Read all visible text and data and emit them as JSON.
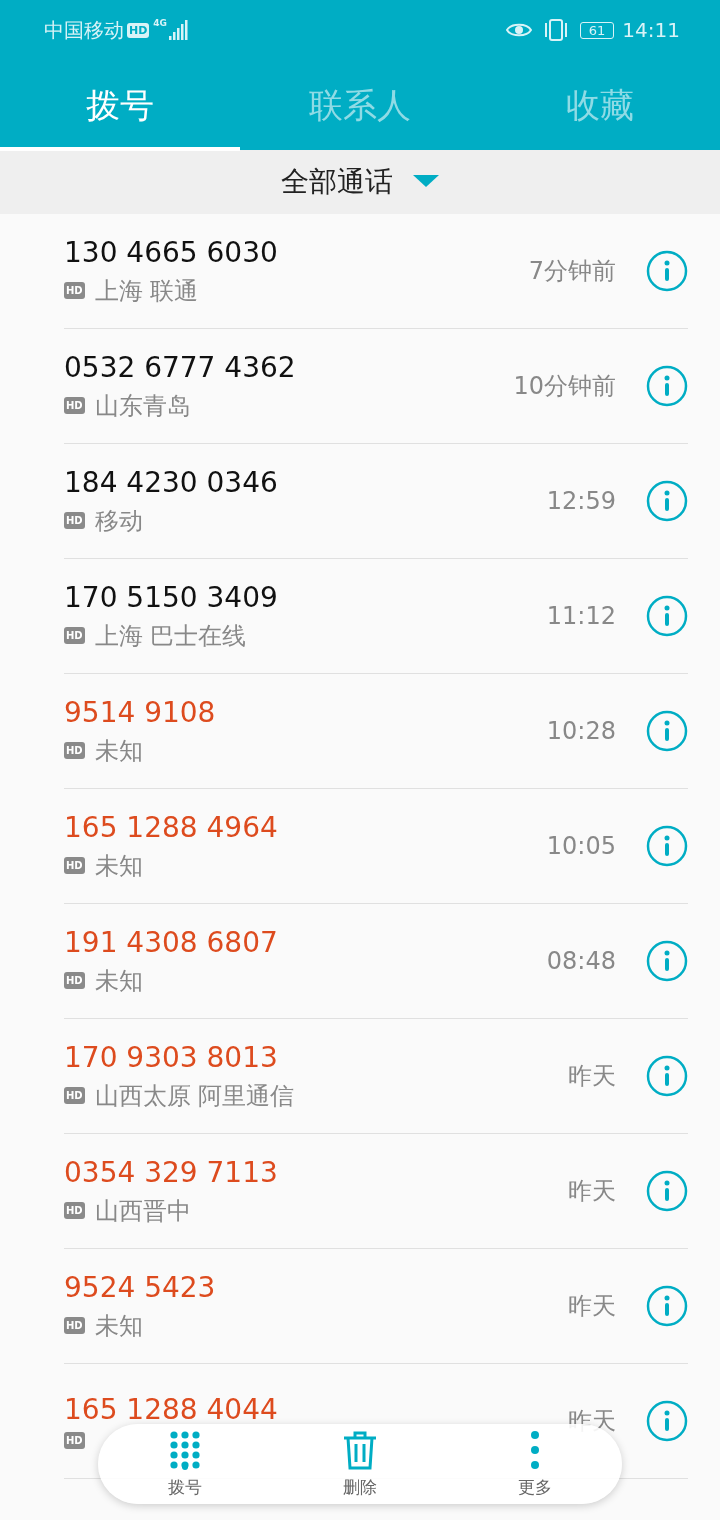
{
  "status_bar": {
    "carrier": "中国移动",
    "hd": "HD",
    "network": "4G",
    "battery": "61",
    "time": "14:11"
  },
  "tabs": [
    {
      "label": "拨号",
      "selected": true
    },
    {
      "label": "联系人",
      "selected": false
    },
    {
      "label": "收藏",
      "selected": false
    }
  ],
  "filter": {
    "label": "全部通话"
  },
  "calls": [
    {
      "number": "130 4665 6030",
      "badge": "HD",
      "location": "上海 联通",
      "time": "7分钟前",
      "missed": false
    },
    {
      "number": "0532 6777 4362",
      "badge": "HD",
      "location": "山东青岛",
      "time": "10分钟前",
      "missed": false
    },
    {
      "number": "184 4230 0346",
      "badge": "HD",
      "location": "移动",
      "time": "12:59",
      "missed": false
    },
    {
      "number": "170 5150 3409",
      "badge": "HD",
      "location": "上海 巴士在线",
      "time": "11:12",
      "missed": false
    },
    {
      "number": "9514 9108",
      "badge": "HD",
      "location": "未知",
      "time": "10:28",
      "missed": true
    },
    {
      "number": "165 1288 4964",
      "badge": "HD",
      "location": "未知",
      "time": "10:05",
      "missed": true
    },
    {
      "number": "191 4308 6807",
      "badge": "HD",
      "location": "未知",
      "time": "08:48",
      "missed": true
    },
    {
      "number": "170 9303 8013",
      "badge": "HD",
      "location": "山西太原 阿里通信",
      "time": "昨天",
      "missed": true
    },
    {
      "number": "0354 329 7113",
      "badge": "HD",
      "location": "山西晋中",
      "time": "昨天",
      "missed": true
    },
    {
      "number": "9524 5423",
      "badge": "HD",
      "location": "未知",
      "time": "昨天",
      "missed": true
    },
    {
      "number": "165 1288 4044",
      "badge": "HD",
      "time": "昨天",
      "missed": true
    }
  ],
  "bottom_bar": [
    {
      "kind": "dialpad",
      "label": "拨号"
    },
    {
      "kind": "delete",
      "label": "删除"
    },
    {
      "kind": "more",
      "label": "更多"
    }
  ]
}
